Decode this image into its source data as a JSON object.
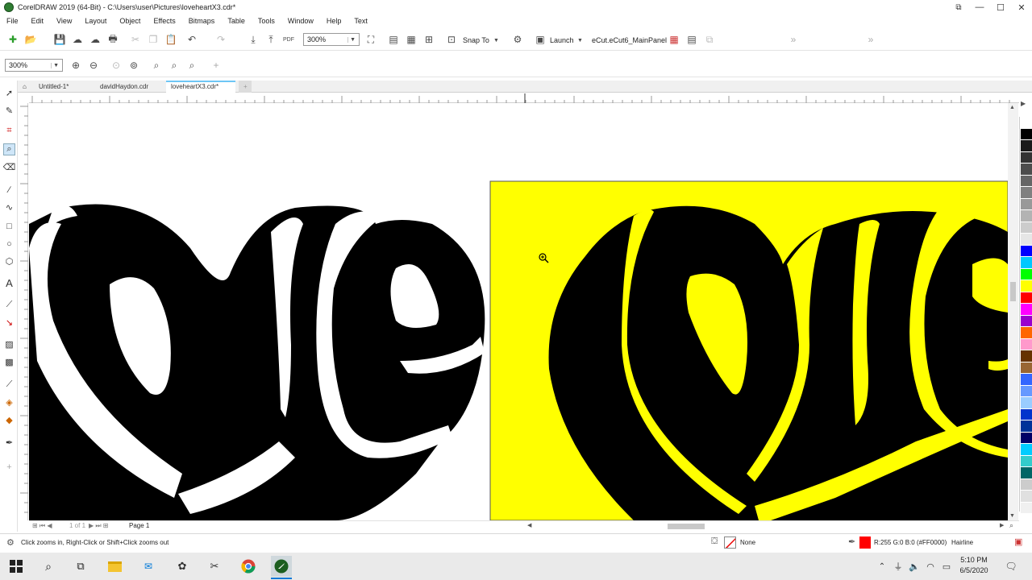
{
  "window": {
    "title": "CorelDRAW 2019 (64-Bit) - C:\\Users\\user\\Pictures\\loveheartX3.cdr*",
    "minimize": "—",
    "maximize": "☐",
    "close": "✕"
  },
  "menu": [
    "File",
    "Edit",
    "View",
    "Layout",
    "Object",
    "Effects",
    "Bitmaps",
    "Table",
    "Tools",
    "Window",
    "Help",
    "Text"
  ],
  "toolbar": {
    "zoom_value": "300%",
    "snap_label": "Snap To",
    "launch_label": "Launch",
    "panel_label": "eCut.eCut6_MainPanel"
  },
  "propbar": {
    "zoom_value": "300%"
  },
  "tabs": [
    {
      "label": "Untitled-1*"
    },
    {
      "label": "davidHaydon.cdr"
    },
    {
      "label": "loveheartX3.cdr*"
    }
  ],
  "canvas": {
    "left_text": "love",
    "right_text": "love",
    "bg_color": "#ffff00"
  },
  "page_nav": {
    "page_of": "1 of 1",
    "page_label": "Page 1"
  },
  "status": {
    "hint": "Click zooms in, Right-Click or Shift+Click zooms out",
    "fill_label": "None",
    "outline_color_text": "R:255 G:0 B:0 (#FF0000)",
    "outline_width": "Hairline"
  },
  "palette_colors": [
    "#ffffff",
    "#000000",
    "#1a1a1a",
    "#333333",
    "#4d4d4d",
    "#666666",
    "#808080",
    "#999999",
    "#b3b3b3",
    "#cccccc",
    "#e6e6e6",
    "#0000ff",
    "#00c8ff",
    "#00ff00",
    "#ffff00",
    "#ff0000",
    "#ff00ff",
    "#9900cc",
    "#ff6600",
    "#ff99cc",
    "#663300",
    "#996633",
    "#3366ff",
    "#6699ff",
    "#99ccff",
    "#0033cc",
    "#003399",
    "#000066",
    "#00ccff",
    "#33cccc",
    "#006666",
    "#cccccc",
    "#e0e0e0",
    "#f0f0f0"
  ],
  "taskbar": {
    "time": "5:10 PM",
    "date": "6/5/2020"
  }
}
